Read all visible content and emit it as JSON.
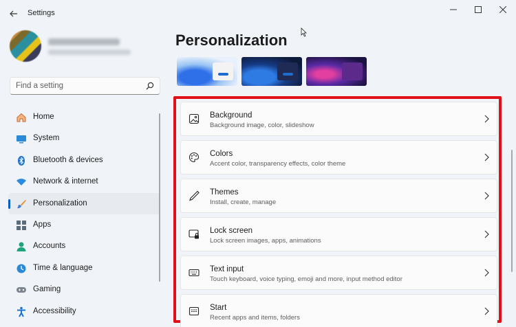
{
  "window": {
    "title": "Settings",
    "controls": {
      "minimize": "minimize-icon",
      "maximize": "maximize-icon",
      "close": "close-icon"
    }
  },
  "sidebar": {
    "search": {
      "placeholder": "Find a setting"
    },
    "items": [
      {
        "label": "Home",
        "icon": "home-icon",
        "active": false
      },
      {
        "label": "System",
        "icon": "system-icon",
        "active": false
      },
      {
        "label": "Bluetooth & devices",
        "icon": "bluetooth-icon",
        "active": false
      },
      {
        "label": "Network & internet",
        "icon": "wifi-icon",
        "active": false
      },
      {
        "label": "Personalization",
        "icon": "brush-icon",
        "active": true
      },
      {
        "label": "Apps",
        "icon": "apps-icon",
        "active": false
      },
      {
        "label": "Accounts",
        "icon": "accounts-icon",
        "active": false
      },
      {
        "label": "Time & language",
        "icon": "clock-icon",
        "active": false
      },
      {
        "label": "Gaming",
        "icon": "gamepad-icon",
        "active": false
      },
      {
        "label": "Accessibility",
        "icon": "accessibility-icon",
        "active": false
      }
    ]
  },
  "main": {
    "title": "Personalization",
    "themes": [
      "theme-light",
      "theme-dark-blue",
      "theme-purple"
    ],
    "cards": [
      {
        "title": "Background",
        "subtitle": "Background image, color, slideshow",
        "icon": "image-icon"
      },
      {
        "title": "Colors",
        "subtitle": "Accent color, transparency effects, color theme",
        "icon": "palette-icon"
      },
      {
        "title": "Themes",
        "subtitle": "Install, create, manage",
        "icon": "pen-icon"
      },
      {
        "title": "Lock screen",
        "subtitle": "Lock screen images, apps, animations",
        "icon": "lock-screen-icon"
      },
      {
        "title": "Text input",
        "subtitle": "Touch keyboard, voice typing, emoji and more, input method editor",
        "icon": "keyboard-icon"
      },
      {
        "title": "Start",
        "subtitle": "Recent apps and items, folders",
        "icon": "start-icon"
      }
    ]
  },
  "colors": {
    "accent": "#0a5fbf",
    "highlight_box": "#e0101b"
  }
}
